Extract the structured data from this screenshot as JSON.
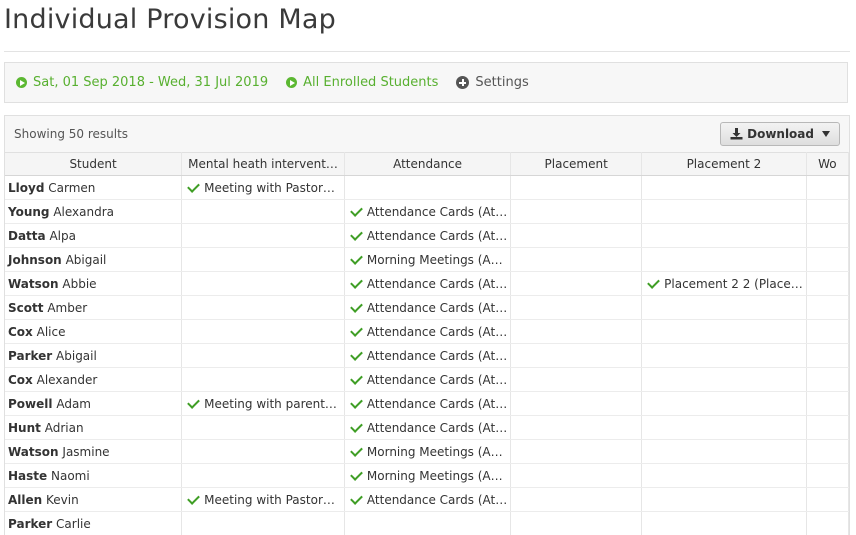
{
  "page_title": "Individual Provision Map",
  "filters": {
    "date_range": "Sat, 01 Sep 2018 - Wed, 31 Jul 2019",
    "students": "All Enrolled Students",
    "settings": "Settings"
  },
  "results": {
    "count_label": "Showing 50 results",
    "download_label": "Download"
  },
  "table": {
    "columns": [
      "Student",
      "Mental heath intervent…",
      "Attendance",
      "Placement",
      "Placement 2",
      "Wo"
    ],
    "rows": [
      {
        "surname": "Lloyd",
        "first": "Carmen",
        "mh": "Meeting with Pastor…",
        "att": "",
        "pl": "",
        "pl2": ""
      },
      {
        "surname": "Young",
        "first": "Alexandra",
        "mh": "",
        "att": "Attendance Cards (At…",
        "pl": "",
        "pl2": ""
      },
      {
        "surname": "Datta",
        "first": "Alpa",
        "mh": "",
        "att": "Attendance Cards (At…",
        "pl": "",
        "pl2": ""
      },
      {
        "surname": "Johnson",
        "first": "Abigail",
        "mh": "",
        "att": "Morning Meetings (A…",
        "pl": "",
        "pl2": ""
      },
      {
        "surname": "Watson",
        "first": "Abbie",
        "mh": "",
        "att": "Attendance Cards (At…",
        "pl": "",
        "pl2": "Placement 2 2 (Place…"
      },
      {
        "surname": "Scott",
        "first": "Amber",
        "mh": "",
        "att": "Attendance Cards (At…",
        "pl": "",
        "pl2": ""
      },
      {
        "surname": "Cox",
        "first": "Alice",
        "mh": "",
        "att": "Attendance Cards (At…",
        "pl": "",
        "pl2": ""
      },
      {
        "surname": "Parker",
        "first": "Abigail",
        "mh": "",
        "att": "Attendance Cards (At…",
        "pl": "",
        "pl2": ""
      },
      {
        "surname": "Cox",
        "first": "Alexander",
        "mh": "",
        "att": "Attendance Cards (At…",
        "pl": "",
        "pl2": ""
      },
      {
        "surname": "Powell",
        "first": "Adam",
        "mh": "Meeting with parent…",
        "att": "Attendance Cards (At…",
        "pl": "",
        "pl2": ""
      },
      {
        "surname": "Hunt",
        "first": "Adrian",
        "mh": "",
        "att": "Attendance Cards (At…",
        "pl": "",
        "pl2": ""
      },
      {
        "surname": "Watson",
        "first": "Jasmine",
        "mh": "",
        "att": "Morning Meetings (A…",
        "pl": "",
        "pl2": ""
      },
      {
        "surname": "Haste",
        "first": "Naomi",
        "mh": "",
        "att": "Morning Meetings (A…",
        "pl": "",
        "pl2": ""
      },
      {
        "surname": "Allen",
        "first": "Kevin",
        "mh": "Meeting with Pastor…",
        "att": "Attendance Cards (At…",
        "pl": "",
        "pl2": ""
      },
      {
        "surname": "Parker",
        "first": "Carlie",
        "mh": "",
        "att": "",
        "pl": "",
        "pl2": ""
      }
    ]
  },
  "colors": {
    "accent_green": "#58b030",
    "check_green": "#3f9e25"
  },
  "icons": {
    "date_range": "play-circle-icon",
    "students": "play-circle-icon",
    "settings": "plus-circle-icon",
    "download": "download-icon",
    "download_menu": "caret-down-icon",
    "provision_entry": "check-icon"
  }
}
